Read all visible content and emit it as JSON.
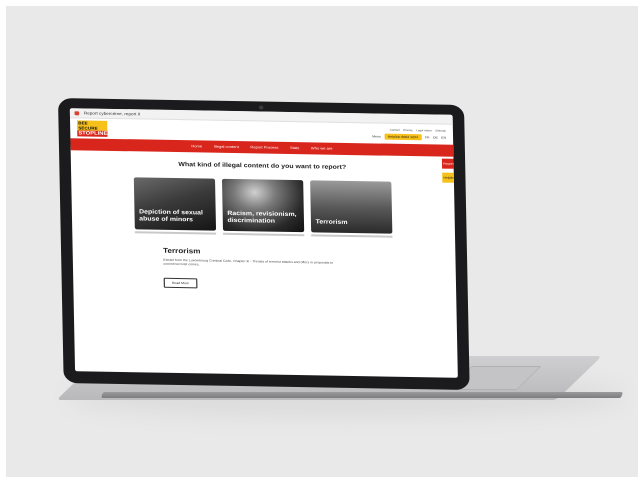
{
  "browser": {
    "tab_title": "Report cybercrime, report it"
  },
  "header": {
    "logo_top": "BEE SECURE",
    "logo_bottom": "STOPLINE",
    "top_links": [
      "Contact",
      "Privacy",
      "Legal notice",
      "Sitemap"
    ],
    "menu_label": "Menu",
    "helpline_label": "Helpline 8002 1234",
    "languages": [
      "FR",
      "DE",
      "EN"
    ]
  },
  "nav": {
    "items": [
      "Home",
      "Illegal content",
      "Report Process",
      "Stats",
      "Who we are"
    ]
  },
  "side": {
    "report_label": "Report",
    "help_label": "Helpline"
  },
  "main": {
    "question": "What kind of illegal content do you want to report?",
    "cards": [
      {
        "label": "Depiction of sexual abuse of minors"
      },
      {
        "label": "Racism, revisionism, discrimination"
      },
      {
        "label": "Terrorism"
      }
    ],
    "detail": {
      "title": "Terrorism",
      "text": "Extract from the Luxembourg Criminal Code, Chapter III - Threats of terrorist attacks and offers or proposals to commit terrorist crimes.",
      "button_label": "Read More"
    }
  },
  "colors": {
    "brand_red": "#d9261c",
    "brand_yellow": "#f7c11b",
    "laptop_frame": "#1b1b1d",
    "laptop_body": "#c4c4c6"
  }
}
